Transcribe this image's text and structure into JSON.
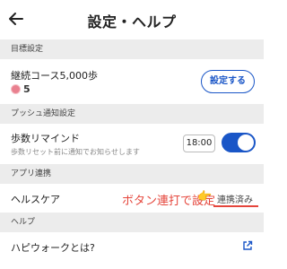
{
  "header": {
    "title": "設定・ヘルプ",
    "back_icon": "arrow-left-icon"
  },
  "sections": {
    "goal": {
      "heading": "目標設定",
      "course_label": "継続コース5,000歩",
      "medal_icon": "medal-icon",
      "medal_count": "5",
      "button_label": "設定する"
    },
    "push": {
      "heading": "プッシュ通知設定",
      "label": "歩数リマインド",
      "sub": "歩数リセット前に通知でお知らせします",
      "time": "18:00",
      "toggle_on": true
    },
    "app": {
      "heading": "アプリ連携",
      "label": "ヘルスケア",
      "annotation": "ボタン連打で設定",
      "status": "連携済み"
    },
    "help": {
      "heading": "ヘルプ",
      "item_label": "ハピウォークとは?",
      "external_icon": "external-link-icon"
    }
  },
  "colors": {
    "accent": "#1a56c7",
    "annotation": "#e5463c",
    "section_bg": "#ececec"
  }
}
